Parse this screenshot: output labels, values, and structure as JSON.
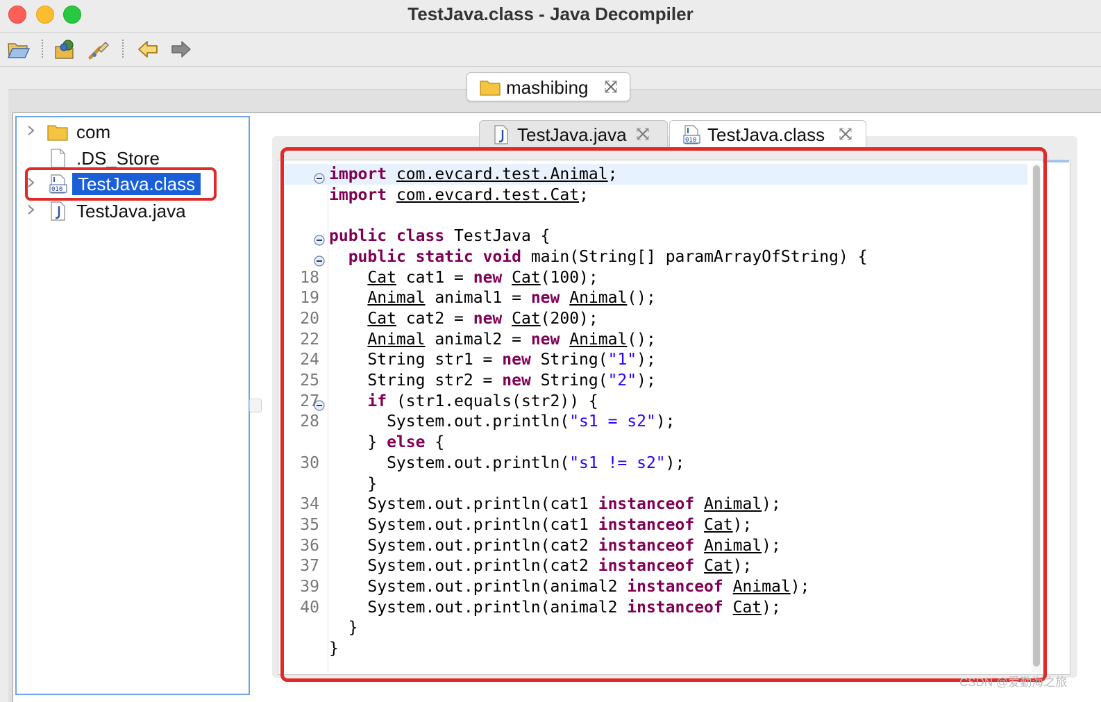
{
  "window": {
    "title": "TestJava.class - Java Decompiler"
  },
  "project_tab": {
    "label": "mashibing"
  },
  "tree": {
    "items": [
      {
        "label": "com",
        "icon": "folder-icon",
        "expandable": true,
        "selected": false
      },
      {
        "label": ".DS_Store",
        "icon": "file-icon",
        "expandable": false,
        "selected": false
      },
      {
        "label": "TestJava.class",
        "icon": "class-file-icon",
        "expandable": true,
        "selected": true
      },
      {
        "label": "TestJava.java",
        "icon": "java-file-icon",
        "expandable": true,
        "selected": false
      }
    ]
  },
  "editor_tabs": [
    {
      "label": "TestJava.java",
      "active": false
    },
    {
      "label": "TestJava.class",
      "active": true
    }
  ],
  "code": {
    "lines": [
      {
        "number": "",
        "fold": true,
        "highlight": true,
        "tokens": [
          [
            "kw",
            "import"
          ],
          [
            "t",
            " "
          ],
          [
            "ul",
            "com.evcard.test.Animal"
          ],
          [
            "t",
            ";"
          ]
        ]
      },
      {
        "number": "",
        "fold": false,
        "tokens": [
          [
            "kw",
            "import"
          ],
          [
            "t",
            " "
          ],
          [
            "ul",
            "com.evcard.test.Cat"
          ],
          [
            "t",
            ";"
          ]
        ]
      },
      {
        "number": "",
        "fold": false,
        "tokens": []
      },
      {
        "number": "",
        "fold": true,
        "tokens": [
          [
            "kw",
            "public"
          ],
          [
            "t",
            " "
          ],
          [
            "kw",
            "class"
          ],
          [
            "t",
            " TestJava {"
          ]
        ]
      },
      {
        "number": "",
        "fold": true,
        "tokens": [
          [
            "t",
            "  "
          ],
          [
            "kw",
            "public"
          ],
          [
            "t",
            " "
          ],
          [
            "kw",
            "static"
          ],
          [
            "t",
            " "
          ],
          [
            "kw",
            "void"
          ],
          [
            "t",
            " main(String[] paramArrayOfString) {"
          ]
        ]
      },
      {
        "number": "18",
        "fold": false,
        "tokens": [
          [
            "t",
            "    "
          ],
          [
            "ul",
            "Cat"
          ],
          [
            "t",
            " cat1 = "
          ],
          [
            "kw",
            "new"
          ],
          [
            "t",
            " "
          ],
          [
            "ul",
            "Cat"
          ],
          [
            "t",
            "(100);"
          ]
        ]
      },
      {
        "number": "19",
        "fold": false,
        "tokens": [
          [
            "t",
            "    "
          ],
          [
            "ul",
            "Animal"
          ],
          [
            "t",
            " animal1 = "
          ],
          [
            "kw",
            "new"
          ],
          [
            "t",
            " "
          ],
          [
            "ul",
            "Animal"
          ],
          [
            "t",
            "();"
          ]
        ]
      },
      {
        "number": "20",
        "fold": false,
        "tokens": [
          [
            "t",
            "    "
          ],
          [
            "ul",
            "Cat"
          ],
          [
            "t",
            " cat2 = "
          ],
          [
            "kw",
            "new"
          ],
          [
            "t",
            " "
          ],
          [
            "ul",
            "Cat"
          ],
          [
            "t",
            "(200);"
          ]
        ]
      },
      {
        "number": "22",
        "fold": false,
        "tokens": [
          [
            "t",
            "    "
          ],
          [
            "ul",
            "Animal"
          ],
          [
            "t",
            " animal2 = "
          ],
          [
            "kw",
            "new"
          ],
          [
            "t",
            " "
          ],
          [
            "ul",
            "Animal"
          ],
          [
            "t",
            "();"
          ]
        ]
      },
      {
        "number": "24",
        "fold": false,
        "tokens": [
          [
            "t",
            "    String str1 = "
          ],
          [
            "kw",
            "new"
          ],
          [
            "t",
            " String("
          ],
          [
            "str",
            "\"1\""
          ],
          [
            "t",
            ");"
          ]
        ]
      },
      {
        "number": "25",
        "fold": false,
        "tokens": [
          [
            "t",
            "    String str2 = "
          ],
          [
            "kw",
            "new"
          ],
          [
            "t",
            " String("
          ],
          [
            "str",
            "\"2\""
          ],
          [
            "t",
            ");"
          ]
        ]
      },
      {
        "number": "27",
        "fold": true,
        "tokens": [
          [
            "t",
            "    "
          ],
          [
            "kw",
            "if"
          ],
          [
            "t",
            " (str1.equals(str2)) {"
          ]
        ]
      },
      {
        "number": "28",
        "fold": false,
        "tokens": [
          [
            "t",
            "      System.out.println("
          ],
          [
            "str",
            "\"s1 = s2\""
          ],
          [
            "t",
            ");"
          ]
        ]
      },
      {
        "number": "",
        "fold": false,
        "tokens": [
          [
            "t",
            "    } "
          ],
          [
            "kw",
            "else"
          ],
          [
            "t",
            " {"
          ]
        ]
      },
      {
        "number": "30",
        "fold": false,
        "tokens": [
          [
            "t",
            "      System.out.println("
          ],
          [
            "str",
            "\"s1 != s2\""
          ],
          [
            "t",
            ");"
          ]
        ]
      },
      {
        "number": "",
        "fold": false,
        "tokens": [
          [
            "t",
            "    }"
          ]
        ]
      },
      {
        "number": "34",
        "fold": false,
        "tokens": [
          [
            "t",
            "    System.out.println(cat1 "
          ],
          [
            "kw",
            "instanceof"
          ],
          [
            "t",
            " "
          ],
          [
            "ul",
            "Animal"
          ],
          [
            "t",
            ");"
          ]
        ]
      },
      {
        "number": "35",
        "fold": false,
        "tokens": [
          [
            "t",
            "    System.out.println(cat1 "
          ],
          [
            "kw",
            "instanceof"
          ],
          [
            "t",
            " "
          ],
          [
            "ul",
            "Cat"
          ],
          [
            "t",
            ");"
          ]
        ]
      },
      {
        "number": "36",
        "fold": false,
        "tokens": [
          [
            "t",
            "    System.out.println(cat2 "
          ],
          [
            "kw",
            "instanceof"
          ],
          [
            "t",
            " "
          ],
          [
            "ul",
            "Animal"
          ],
          [
            "t",
            ");"
          ]
        ]
      },
      {
        "number": "37",
        "fold": false,
        "tokens": [
          [
            "t",
            "    System.out.println(cat2 "
          ],
          [
            "kw",
            "instanceof"
          ],
          [
            "t",
            " "
          ],
          [
            "ul",
            "Cat"
          ],
          [
            "t",
            ");"
          ]
        ]
      },
      {
        "number": "39",
        "fold": false,
        "tokens": [
          [
            "t",
            "    System.out.println(animal2 "
          ],
          [
            "kw",
            "instanceof"
          ],
          [
            "t",
            " "
          ],
          [
            "ul",
            "Animal"
          ],
          [
            "t",
            ");"
          ]
        ]
      },
      {
        "number": "40",
        "fold": false,
        "tokens": [
          [
            "t",
            "    System.out.println(animal2 "
          ],
          [
            "kw",
            "instanceof"
          ],
          [
            "t",
            " "
          ],
          [
            "ul",
            "Cat"
          ],
          [
            "t",
            ");"
          ]
        ]
      },
      {
        "number": "",
        "fold": false,
        "tokens": [
          [
            "t",
            "  }"
          ]
        ]
      },
      {
        "number": "",
        "fold": false,
        "tokens": [
          [
            "t",
            "}"
          ]
        ]
      }
    ]
  },
  "watermark": "CSDN @爱勤海之旅",
  "colors": {
    "keyword": "#7f0055",
    "string": "#2a00ff",
    "selection": "#1a5fd7",
    "annotation_red": "#e02a2a"
  }
}
